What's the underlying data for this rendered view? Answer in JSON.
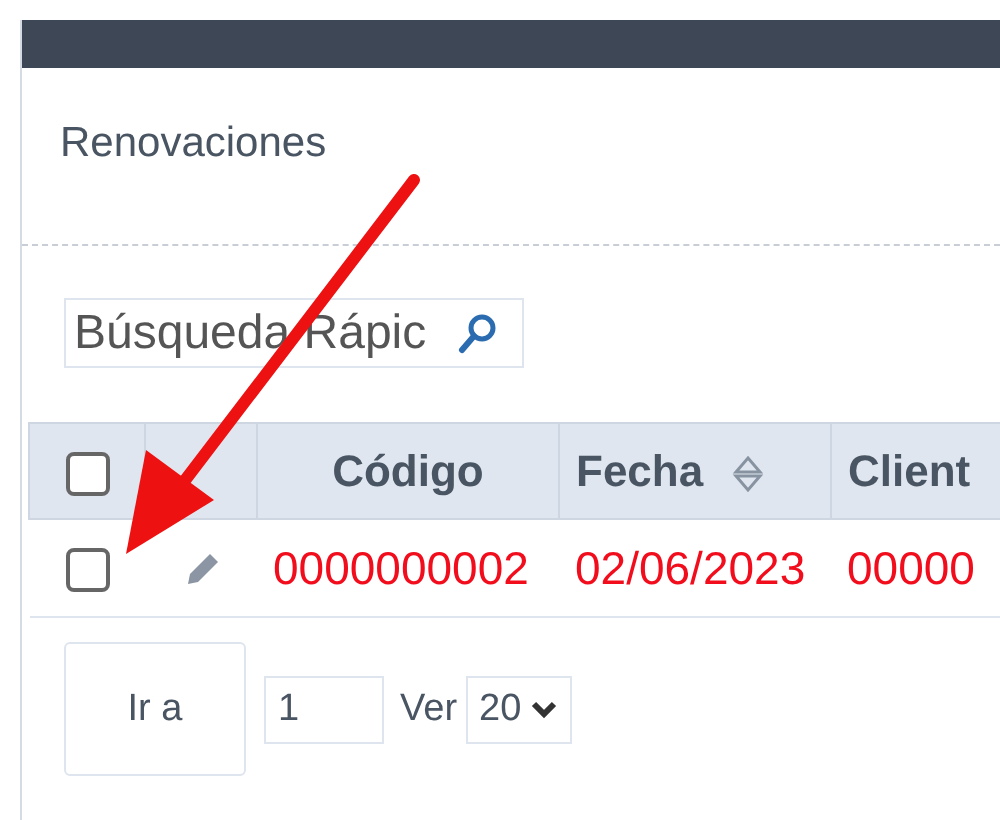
{
  "panel": {
    "title": "Renovaciones"
  },
  "search": {
    "placeholder": "Búsqueda Rápic"
  },
  "table": {
    "select_all": {
      "checked": false
    },
    "columns": [
      {
        "label": "Código",
        "sortable": false
      },
      {
        "label": "Fecha",
        "sortable": true
      },
      {
        "label": "Client",
        "sortable": false
      }
    ],
    "rows": [
      {
        "checked": false,
        "cells": [
          "0000000002",
          "02/06/2023",
          "00000"
        ]
      }
    ]
  },
  "pagination": {
    "goto_button": "Ir a",
    "page": "1",
    "view_label": "Ver",
    "page_size": "20"
  }
}
